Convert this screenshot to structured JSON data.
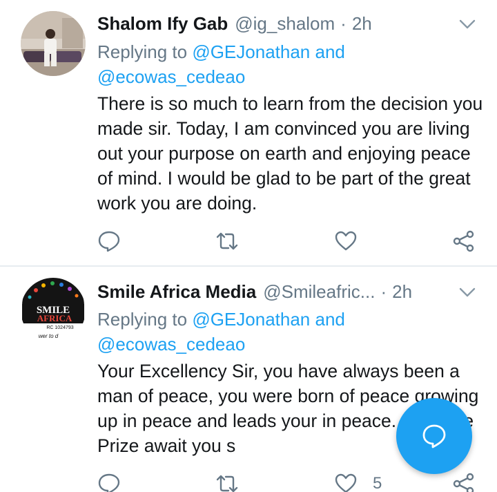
{
  "tweets": [
    {
      "display_name": "Shalom Ify Gab",
      "handle": "@ig_shalom",
      "separator": "·",
      "time": "2h",
      "reply_prefix": "Replying to ",
      "mention_1": "@GEJonathan",
      "reply_joiner": " and",
      "mention_2": "@ecowas_cedeao",
      "body": "There is so much to learn from the decision you made sir. Today, I am convinced you are living out your purpose on earth and enjoying peace of mind. I would be glad to be part of the great work you are doing.",
      "like_count": "",
      "avatar_icon": "user-photo-avatar"
    },
    {
      "display_name": "Smile Africa Media",
      "handle": "@Smileafric...",
      "separator": "·",
      "time": "2h",
      "reply_prefix": "Replying to ",
      "mention_1": "@GEJonathan",
      "reply_joiner": " and",
      "mention_2": "@ecowas_cedeao",
      "body": "Your Excellency Sir, you have always been a man of peace, you were born of peace growing up in peace and leads your in peace..... Peace Prize await you s",
      "like_count": "5",
      "avatar_logo_text_1": "SMILE",
      "avatar_logo_text_2": "AFRICA",
      "avatar_logo_text_3": "RC 1024793",
      "avatar_logo_text_4": "wer to d"
    }
  ],
  "icons": {
    "reply": "reply-icon",
    "retweet": "retweet-icon",
    "like": "heart-icon",
    "share": "share-icon",
    "more": "chevron-down-icon",
    "compose": "compose-reply-icon"
  },
  "colors": {
    "accent": "#1da1f2",
    "secondary_text": "#657786",
    "primary_text": "#14171a",
    "divider": "#e6ecf0"
  }
}
